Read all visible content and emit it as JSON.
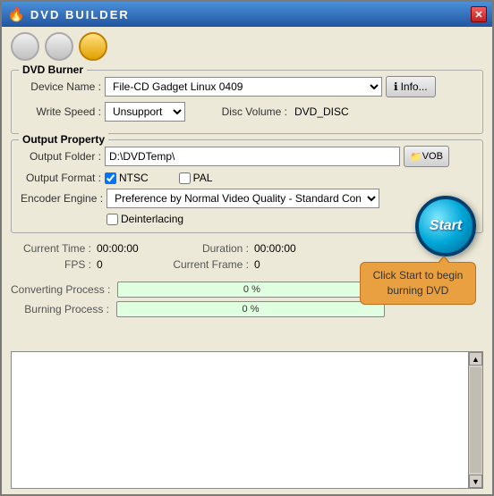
{
  "window": {
    "title": "DVD BUILDER",
    "title_icon": "🔥"
  },
  "toolbar": {
    "btn1": "○",
    "btn2": "○",
    "btn3": "●"
  },
  "dvd_burner": {
    "group_label": "DVD Burner",
    "device_name_label": "Device Name :",
    "device_name_value": "File-CD Gadget  Linux   0409",
    "info_btn_label": "Info...",
    "write_speed_label": "Write Speed :",
    "write_speed_value": "Unsupport",
    "disc_volume_label": "Disc Volume :",
    "disc_volume_value": "DVD_DISC"
  },
  "output_property": {
    "group_label": "Output Property",
    "output_folder_label": "Output Folder :",
    "output_folder_value": "D:\\DVDTemp\\",
    "vob_btn_label": "VOB",
    "output_format_label": "Output Format :",
    "ntsc_label": "NTSC",
    "pal_label": "PAL",
    "encoder_engine_label": "Encoder Engine :",
    "encoder_value": "Preference by Normal Video Quality - Standard Converting speed",
    "deinterlacing_label": "Deinterlacing"
  },
  "stats": {
    "current_time_label": "Current Time :",
    "current_time_value": "00:00:00",
    "duration_label": "Duration :",
    "duration_value": "00:00:00",
    "fps_label": "FPS :",
    "fps_value": "0",
    "current_frame_label": "Current Frame :",
    "current_frame_value": "0"
  },
  "progress": {
    "converting_label": "Converting Process :",
    "converting_value": "0 %",
    "burning_label": "Burning Process :",
    "burning_value": "0 %"
  },
  "start_btn": {
    "label": "Start"
  },
  "tooltip": {
    "text": "Click Start to begin burning DVD"
  }
}
